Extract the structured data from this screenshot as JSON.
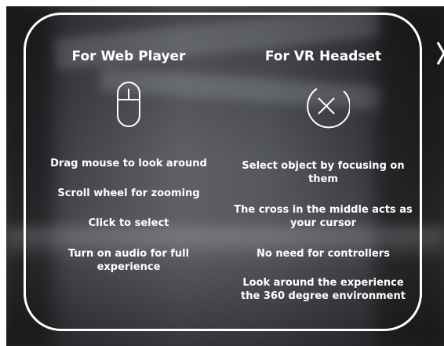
{
  "left_column": {
    "title": "For Web Player",
    "icon": "mouse-icon",
    "items": [
      "Drag mouse to look around",
      "Scroll wheel for zooming",
      "Click to select",
      "Turn on audio for full experience"
    ]
  },
  "right_column": {
    "title": "For VR Headset",
    "icon": "cross-cursor-icon",
    "items": [
      "Select object by focusing on them",
      "The cross in the middle acts as your cursor",
      "No need for controllers",
      "Look around the experience the 360 degree environment"
    ]
  },
  "next_arrow_icon": "chevron-right-icon",
  "colors": {
    "text": "#ffffff",
    "border": "#ffffff"
  }
}
